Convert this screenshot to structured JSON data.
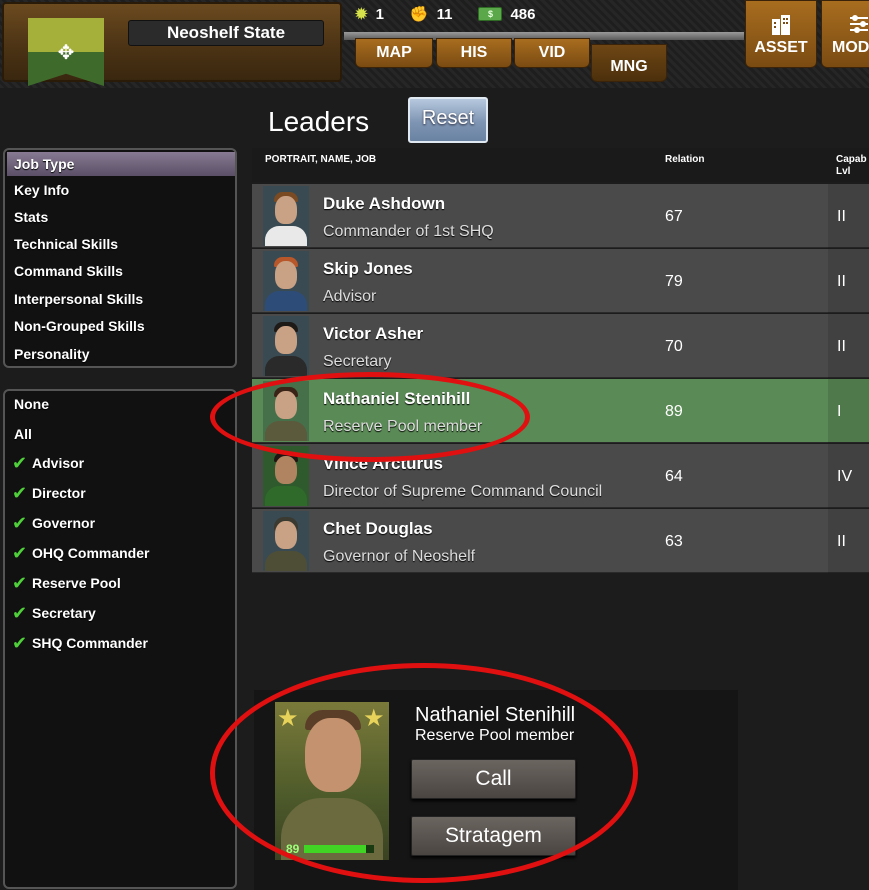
{
  "header": {
    "state_name": "Neoshelf State",
    "stats": [
      {
        "icon": "sun-icon",
        "value": "1"
      },
      {
        "icon": "fist-icon",
        "value": "11"
      },
      {
        "icon": "cash-icon",
        "value": "486"
      }
    ],
    "nav_tabs": [
      {
        "label": "MAP"
      },
      {
        "label": "HIS"
      },
      {
        "label": "VID"
      },
      {
        "label": "MNG",
        "active": true
      }
    ],
    "right_buttons": [
      {
        "label": "ASSET",
        "icon": "buildings-icon"
      },
      {
        "label": "MODE",
        "icon": "sliders-icon"
      }
    ]
  },
  "page": {
    "title": "Leaders",
    "reset_label": "Reset"
  },
  "categories": {
    "selected": "Job Type",
    "items": [
      "Job Type",
      "Key Info",
      "Stats",
      "Technical Skills",
      "Command Skills",
      "Interpersonal Skills",
      "Non-Grouped Skills",
      "Personality"
    ]
  },
  "filters": {
    "none_label": "None",
    "all_label": "All",
    "items": [
      "Advisor",
      "Director",
      "Governor",
      "OHQ Commander",
      "Reserve Pool",
      "Secretary",
      "SHQ Commander"
    ]
  },
  "table": {
    "columns": [
      "PORTRAIT, NAME, JOB",
      "Relation",
      "Capab Lvl"
    ],
    "rows": [
      {
        "name": "Duke Ashdown",
        "job": "Commander of 1st SHQ",
        "relation": "67",
        "capability": "II"
      },
      {
        "name": "Skip Jones",
        "job": "Advisor",
        "relation": "79",
        "capability": "II"
      },
      {
        "name": "Victor Asher",
        "job": "Secretary",
        "relation": "70",
        "capability": "II"
      },
      {
        "name": "Nathaniel Stenihill",
        "job": "Reserve Pool member",
        "relation": "89",
        "capability": "I",
        "selected": true
      },
      {
        "name": "Vince Arcturus",
        "job": "Director of Supreme Command Council",
        "relation": "64",
        "capability": "IV"
      },
      {
        "name": "Chet Douglas",
        "job": "Governor of Neoshelf",
        "relation": "63",
        "capability": "II"
      }
    ]
  },
  "detail": {
    "name": "Nathaniel Stenihill",
    "job": "Reserve Pool member",
    "level_value": "89",
    "level_fraction": 0.89,
    "call_label": "Call",
    "stratagem_label": "Stratagem"
  },
  "colors": {
    "selected_row": "#5a8a55",
    "annotation_ring": "#e01010",
    "check": "#4fd13a"
  }
}
